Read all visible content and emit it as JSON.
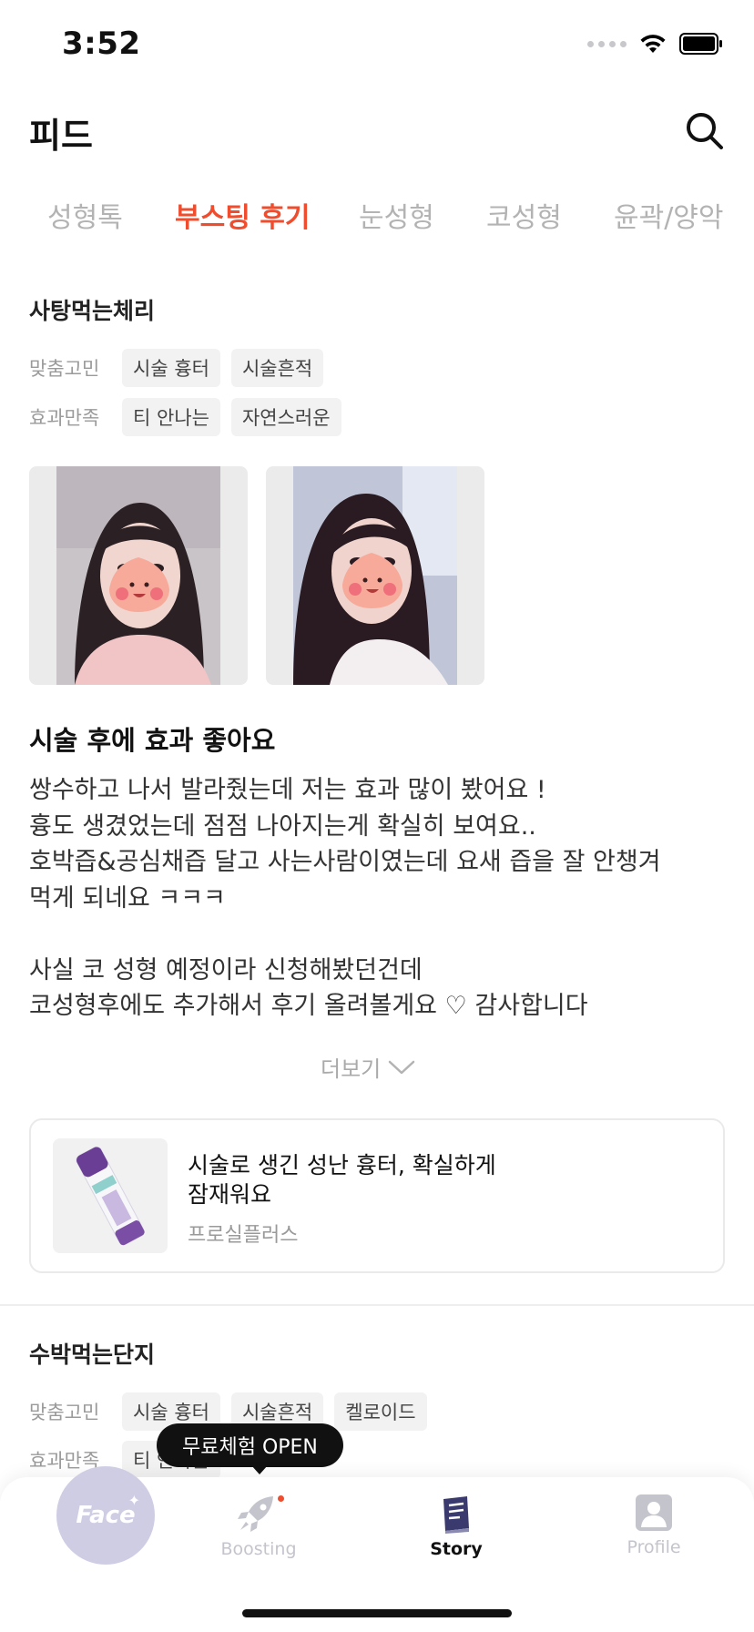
{
  "status_bar": {
    "time": "3:52"
  },
  "header": {
    "title": "피드"
  },
  "tabs": [
    {
      "label": "성형톡",
      "active": false
    },
    {
      "label": "부스팅 후기",
      "active": true
    },
    {
      "label": "눈성형",
      "active": false
    },
    {
      "label": "코성형",
      "active": false
    },
    {
      "label": "윤곽/양악",
      "active": false
    }
  ],
  "post": {
    "author": "사탕먹는체리",
    "concern_label": "맞춤고민",
    "concern_tags": [
      "시술 흉터",
      "시술흔적"
    ],
    "satisfaction_label": "효과만족",
    "satisfaction_tags": [
      "티 안나는",
      "자연스러운"
    ],
    "title": "시술 후에 효과 좋아요",
    "body_lines": [
      "쌍수하고 나서 발라줬는데 저는 효과 많이 봤어요 !",
      "흉도 생겼었는데 점점 나아지는게 확실히 보여요..",
      "호박즙&공심채즙 달고 사는사람이였는데 요새 즙을 잘 안챙겨",
      "먹게 되네요 ㅋㅋㅋ",
      "",
      "사실 코 성형 예정이라 신청해봤던건데",
      "코성형후에도 추가해서 후기 올려볼게요 ♡ 감사합니다"
    ],
    "more_label": "더보기",
    "product": {
      "title_line1": "시술로 생긴 성난 흉터, 확실하게",
      "title_line2": "잠재워요",
      "brand": "프로실플러스"
    }
  },
  "post2": {
    "author": "수박먹는단지",
    "concern_label": "맞춤고민",
    "concern_tags": [
      "시술 흉터",
      "시술흔적",
      "켈로이드"
    ],
    "satisfaction_label": "효과만족",
    "satisfaction_tags": [
      "티 안나는"
    ]
  },
  "tooltip": {
    "text": "무료체험 OPEN"
  },
  "bottom_nav": {
    "face_label": "Face",
    "items": [
      {
        "label": "Boosting",
        "icon": "rocket-icon",
        "active": false
      },
      {
        "label": "Story",
        "icon": "book-icon",
        "active": true
      },
      {
        "label": "Profile",
        "icon": "person-icon",
        "active": false
      }
    ]
  },
  "colors": {
    "accent": "#f04d2e",
    "face_button": "#cfcde4",
    "nav_inactive": "#c4c4cc",
    "story_icon": "#3a3a6e"
  }
}
